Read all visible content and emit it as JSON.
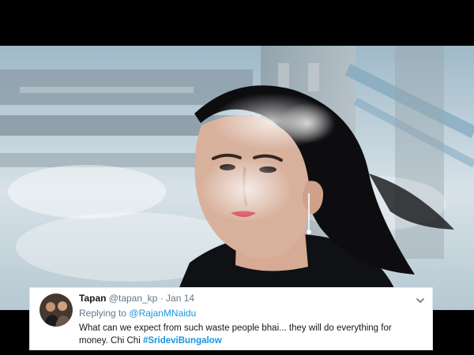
{
  "tweet": {
    "display_name": "Tapan",
    "handle": "@tapan_kp",
    "separator": "·",
    "date": "Jan 14",
    "replying_prefix": "Replying to",
    "replying_to": "@RajanMNaidu",
    "text": "What can we expect from such waste people bhai... they will do everything for money. Chi Chi",
    "hashtag": "#SrideviBungalow",
    "icons": {
      "menu": "chevron-down-icon"
    }
  },
  "colors": {
    "link": "#1b95e0",
    "secondary_text": "#657786",
    "primary_text": "#14171a"
  }
}
